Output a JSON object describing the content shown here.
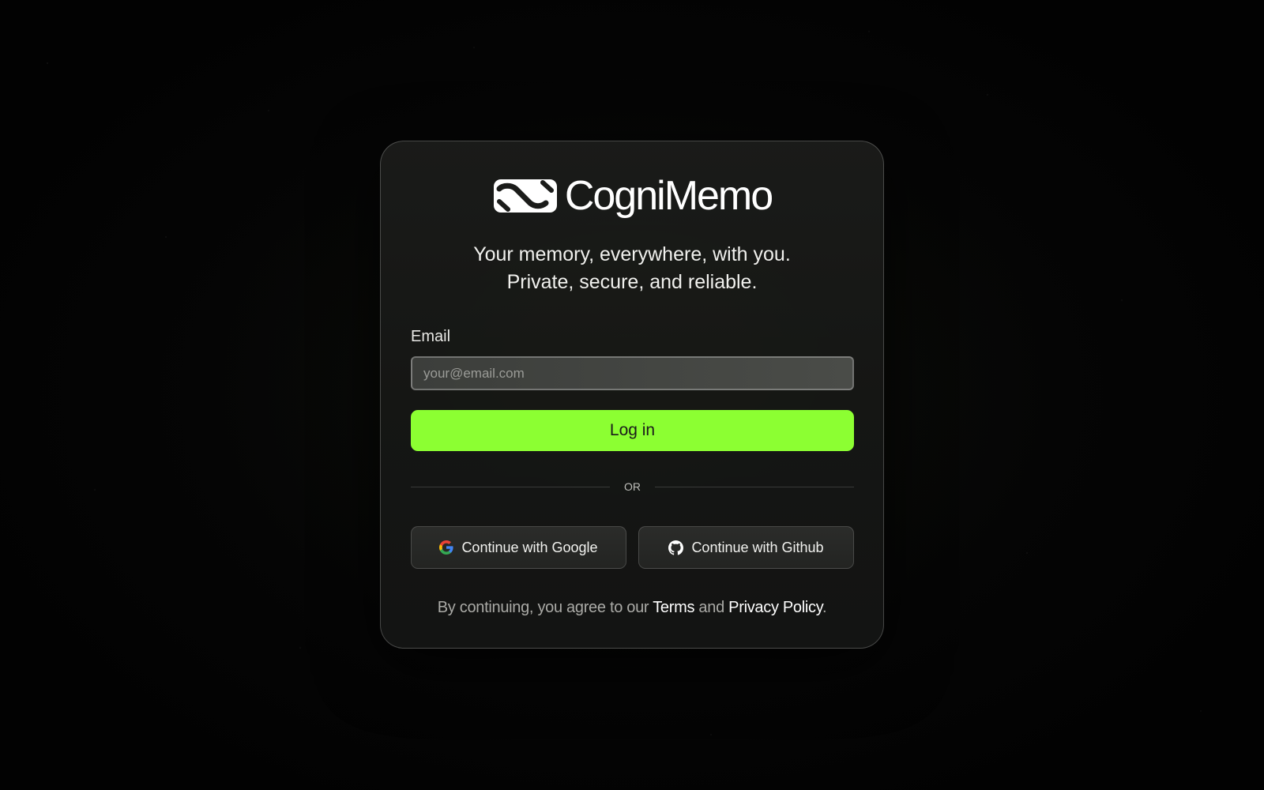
{
  "brand": {
    "name": "CogniMemo",
    "logo_icon": "cognimemo-logo-icon"
  },
  "tagline": {
    "line1": "Your memory, everywhere, with you.",
    "line2": "Private, secure, and reliable."
  },
  "form": {
    "email_label": "Email",
    "email_placeholder": "your@email.com",
    "email_value": "",
    "login_label": "Log in"
  },
  "divider": {
    "text": "OR"
  },
  "oauth": {
    "google_label": "Continue with Google",
    "google_icon": "google-icon",
    "github_label": "Continue with Github",
    "github_icon": "github-icon"
  },
  "legal": {
    "prefix": "By continuing, you agree to our",
    "terms_link": "Terms",
    "conjunction": "and",
    "privacy_link": "Privacy Policy",
    "suffix": "."
  },
  "colors": {
    "accent": "#8cff32",
    "background": "#030303",
    "card": "#1a1b19"
  }
}
